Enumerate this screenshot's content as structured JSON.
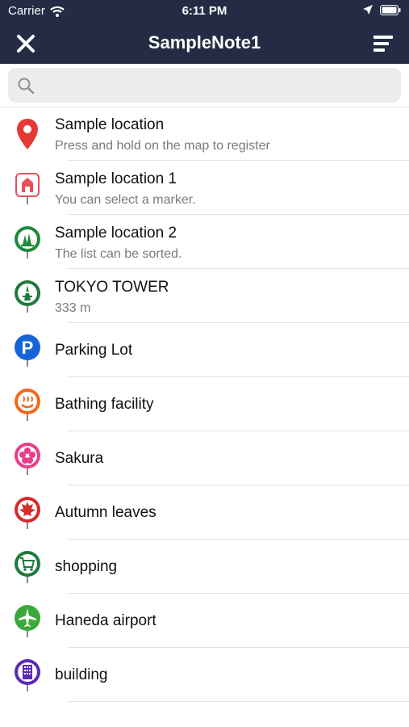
{
  "status_bar": {
    "carrier": "Carrier",
    "time": "6:11 PM"
  },
  "nav": {
    "title": "SampleNote1"
  },
  "search": {
    "placeholder": "",
    "value": ""
  },
  "list": [
    {
      "title": "Sample location",
      "subtitle": "Press and hold on the map to register",
      "icon": "red-map-pin-icon",
      "color": "#e53935"
    },
    {
      "title": "Sample location 1",
      "subtitle": "You can select a marker.",
      "icon": "castle-icon",
      "color": "#e8505b"
    },
    {
      "title": "Sample location 2",
      "subtitle": "The list can be sorted.",
      "icon": "forest-icon",
      "color": "#1e8a3c"
    },
    {
      "title": "TOKYO TOWER",
      "subtitle": "333 m",
      "icon": "tower-icon",
      "color": "#1e7a3c"
    },
    {
      "title": "Parking Lot",
      "subtitle": "",
      "icon": "parking-icon",
      "color": "#1565d8"
    },
    {
      "title": "Bathing facility",
      "subtitle": "",
      "icon": "hot-spring-icon",
      "color": "#f06a1d"
    },
    {
      "title": "Sakura",
      "subtitle": "",
      "icon": "sakura-icon",
      "color": "#e83e8c"
    },
    {
      "title": "Autumn leaves",
      "subtitle": "",
      "icon": "maple-leaf-icon",
      "color": "#d62b2b"
    },
    {
      "title": "shopping",
      "subtitle": "",
      "icon": "shopping-cart-icon",
      "color": "#1e7a3c"
    },
    {
      "title": "Haneda airport",
      "subtitle": "",
      "icon": "airplane-icon",
      "color": "#3aa83a"
    },
    {
      "title": "building",
      "subtitle": "",
      "icon": "building-icon",
      "color": "#5b2bb5"
    }
  ],
  "colors": {
    "header_bg": "#232c44",
    "separator": "#e3e3e3",
    "search_bg": "#ececee"
  }
}
